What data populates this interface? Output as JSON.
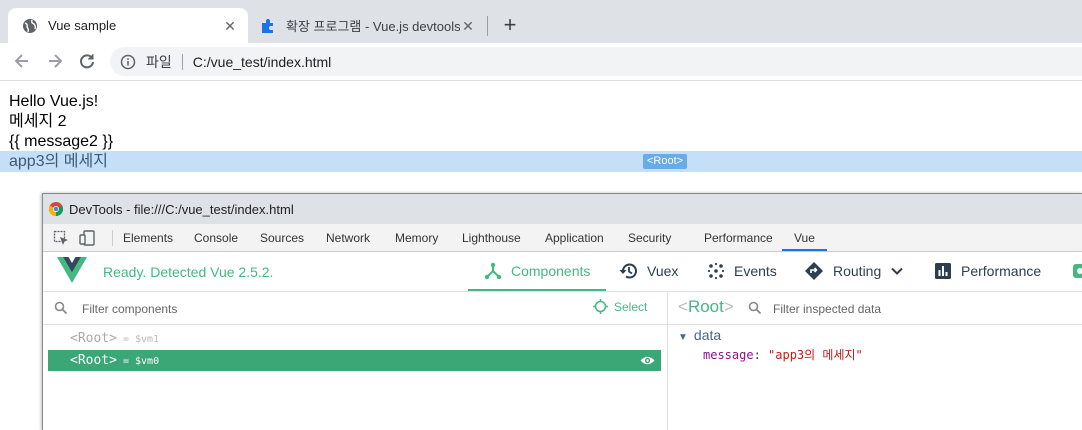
{
  "browser": {
    "tabs": [
      {
        "title": "Vue sample",
        "icon": "globe-icon",
        "active": true
      },
      {
        "title": "확장 프로그램 - Vue.js devtools",
        "icon": "puzzle-piece-icon",
        "active": false
      }
    ],
    "close_glyph": "✕",
    "new_tab_glyph": "+",
    "address": {
      "scheme": "파일",
      "url": "C:/vue_test/index.html"
    }
  },
  "page": {
    "lines": [
      "Hello Vue.js!",
      "메세지 2",
      "{{ message2 }}",
      "app3의 메세지"
    ],
    "highlight_chip": "<Root>"
  },
  "devtools": {
    "window_title": "DevTools - file:///C:/vue_test/index.html",
    "tabs": [
      "Elements",
      "Console",
      "Sources",
      "Network",
      "Memory",
      "Lighthouse",
      "Application",
      "Security",
      "Performance",
      "Vue"
    ],
    "active_tab": "Vue",
    "vue": {
      "status": "Ready. Detected Vue 2.5.2.",
      "nav": [
        {
          "label": "Components",
          "icon": "components-icon",
          "active": true
        },
        {
          "label": "Vuex",
          "icon": "history-icon",
          "active": false
        },
        {
          "label": "Events",
          "icon": "events-icon",
          "active": false
        },
        {
          "label": "Routing",
          "icon": "routing-icon",
          "active": false
        },
        {
          "label": "Performance",
          "icon": "bar-chart-icon",
          "active": false
        }
      ],
      "filter_placeholder": "Filter components",
      "select_label": "Select",
      "tree": [
        {
          "lt": "<",
          "name": "Root",
          "gt": ">",
          "ref": "= $vm1",
          "selected": false
        },
        {
          "lt": "<",
          "name": "Root",
          "gt": ">",
          "ref": "= $vm0",
          "selected": true
        }
      ],
      "inspector": {
        "lt": "<",
        "name": "Root",
        "gt": ">",
        "filter_placeholder": "Filter inspected data",
        "section": "data",
        "props": [
          {
            "key": "message",
            "value": "\"app3의 메세지\""
          }
        ]
      }
    }
  },
  "colors": {
    "vue_green": "#42b983",
    "selected_row": "#3ba776",
    "highlight": "#c5dff8",
    "chip": "#67abea"
  }
}
